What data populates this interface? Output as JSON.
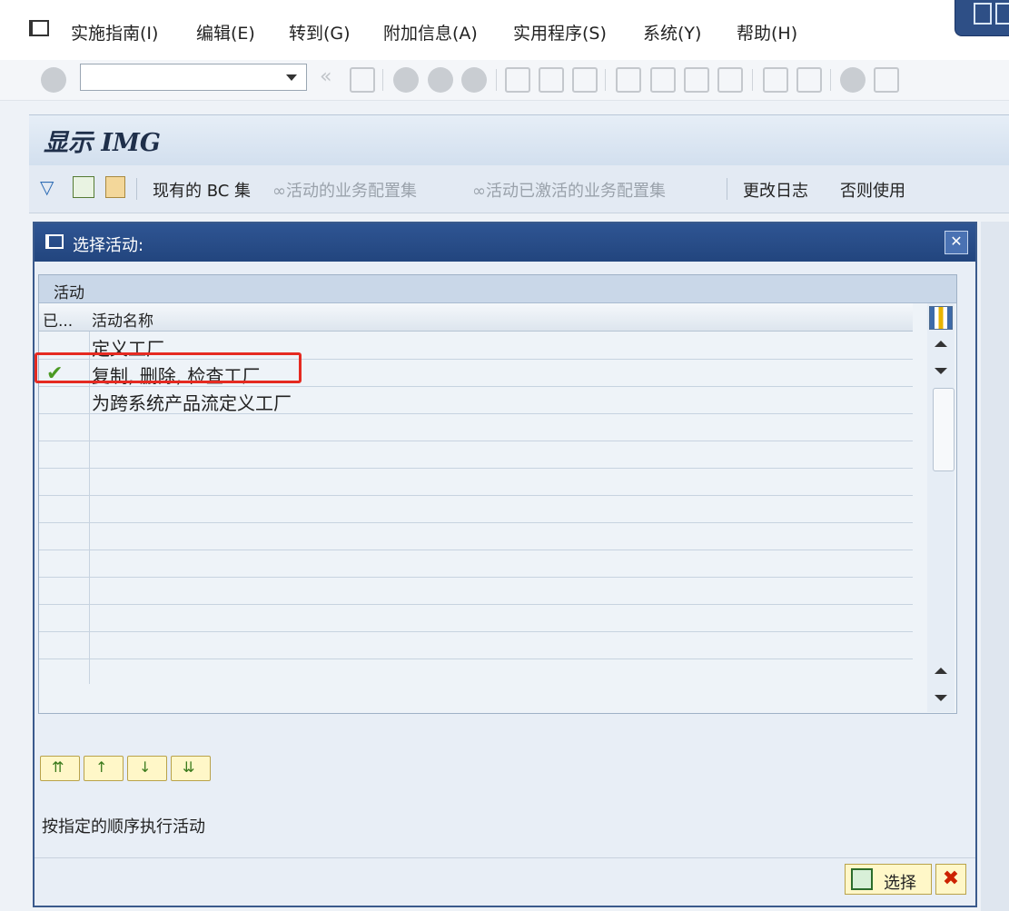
{
  "menubar": {
    "items": [
      "实施指南(I)",
      "编辑(E)",
      "转到(G)",
      "附加信息(A)",
      "实用程序(S)",
      "系统(Y)",
      "帮助(H)"
    ]
  },
  "toolbar": {
    "command_field_value": ""
  },
  "title": "显示 IMG",
  "app_toolbar": {
    "bc_sets": "现有的 BC 集",
    "active_config_sets": "活动的业务配置集",
    "activated_config_sets": "活动已激活的业务配置集",
    "change_log": "更改日志",
    "else_use": "否则使用"
  },
  "dialog": {
    "title": "选择活动:",
    "table_caption": "活动",
    "col_done": "已...",
    "col_name": "活动名称",
    "rows": [
      {
        "name": "定义工厂",
        "done": false
      },
      {
        "name": "复制, 删除, 检查工厂",
        "done": true
      },
      {
        "name": "为跨系统产品流定义工厂",
        "done": false
      }
    ],
    "hint": "按指定的顺序执行活动",
    "choose_label": "选择"
  },
  "icons": {
    "check": "✔",
    "close": "✕",
    "cancel": "✖"
  },
  "colors": {
    "dialog_header": "#2f5593",
    "highlight": "#e52a21",
    "check_green": "#4b9a23"
  }
}
